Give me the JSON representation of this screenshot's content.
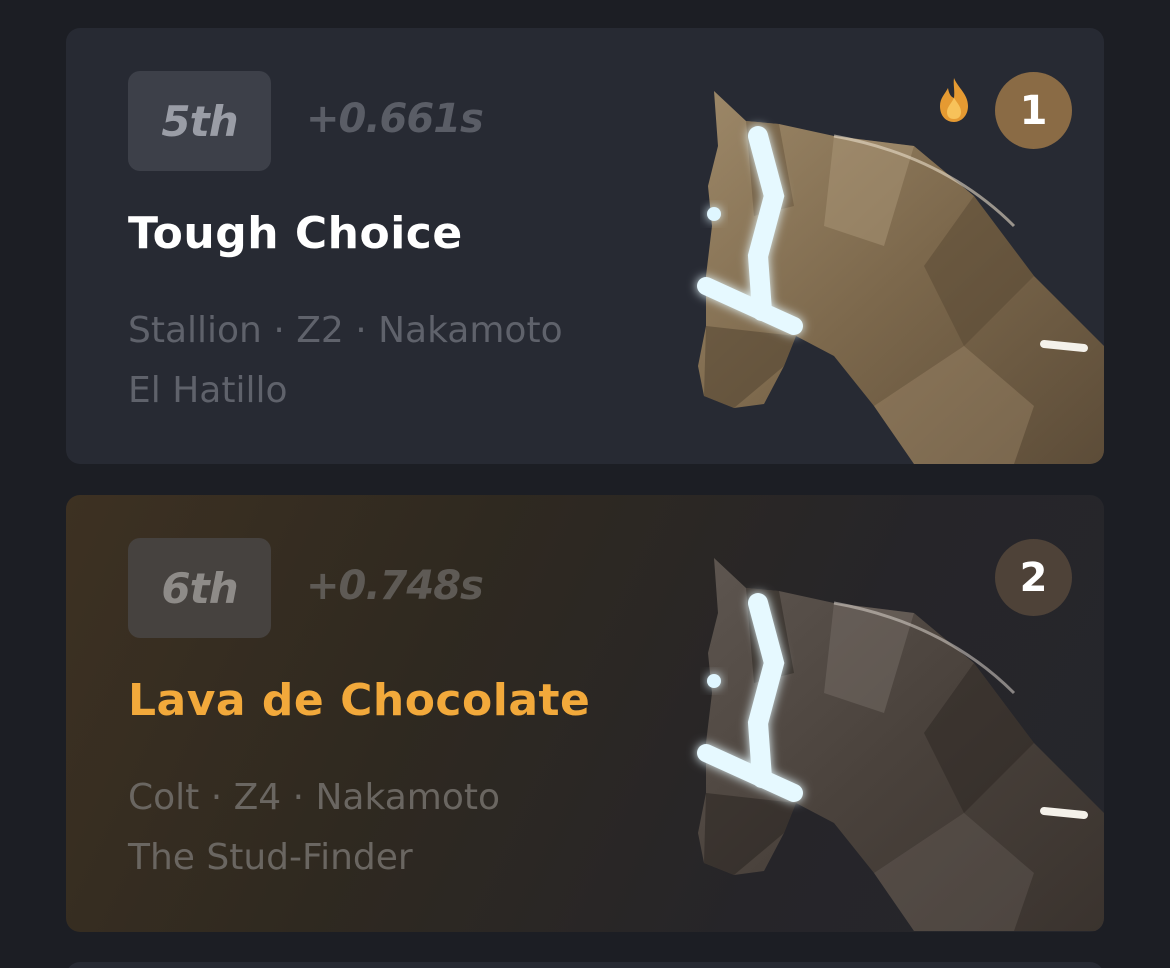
{
  "entries": [
    {
      "position": "5th",
      "gap": "+0.661s",
      "name": "Tough Choice",
      "details_line1": "Stallion · Z2 · Nakamoto",
      "details_line2": "El Hatillo",
      "gate": "1",
      "hot_icon": "fire-icon",
      "horse_color": "#8a7558",
      "highlighted": false
    },
    {
      "position": "6th",
      "gap": "+0.748s",
      "name": "Lava de Chocolate",
      "details_line1": "Colt · Z4 · Nakamoto",
      "details_line2": "The Stud-Finder",
      "gate": "2",
      "horse_color": "#4d4540",
      "highlighted": true
    }
  ],
  "colors": {
    "highlight_name": "#f2a93b",
    "gate_badge_1": "#8a6b45",
    "gate_badge_2": "#4e4238",
    "bridle_glow": "#dff6ff"
  }
}
